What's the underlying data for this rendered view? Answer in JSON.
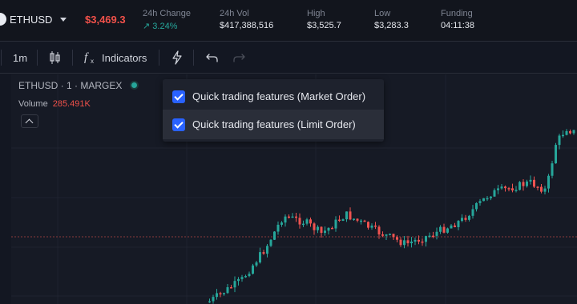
{
  "ticker": {
    "symbol": "ETHUSD",
    "price": "$3,469.3",
    "stats": [
      {
        "label": "24h Change",
        "value": "↗ 3.24%",
        "up": true
      },
      {
        "label": "24h Vol",
        "value": "$417,388,516",
        "up": false
      },
      {
        "label": "High",
        "value": "$3,525.7",
        "up": false
      },
      {
        "label": "Low",
        "value": "$3,283.3",
        "up": false
      },
      {
        "label": "Funding",
        "value": "04:11:38",
        "up": false
      }
    ]
  },
  "toolbar": {
    "interval": "1m",
    "indicators": "Indicators"
  },
  "chart": {
    "title": "ETHUSD · 1 · MARGEX",
    "volume_label": "Volume",
    "volume_value": "285.491K",
    "up_color": "#26a69a",
    "down_color": "#ef5350"
  },
  "menu": {
    "items": [
      {
        "label": "Quick trading features (Market Order)",
        "checked": true
      },
      {
        "label": "Quick trading features (Limit Order)",
        "checked": true
      }
    ]
  }
}
